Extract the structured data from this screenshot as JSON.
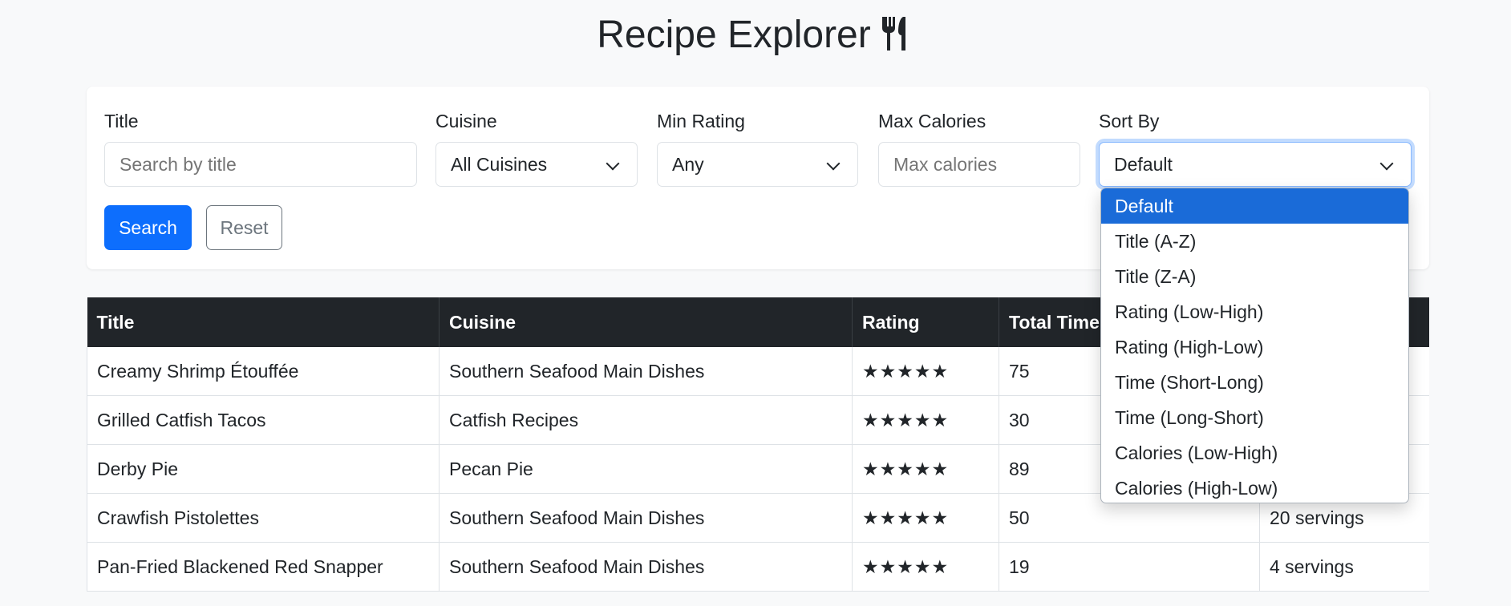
{
  "header": {
    "title": "Recipe Explorer"
  },
  "filters": {
    "title": {
      "label": "Title",
      "placeholder": "Search by title"
    },
    "cuisine": {
      "label": "Cuisine",
      "value": "All Cuisines"
    },
    "min_rating": {
      "label": "Min Rating",
      "value": "Any"
    },
    "max_calories": {
      "label": "Max Calories",
      "placeholder": "Max calories"
    },
    "sort_by": {
      "label": "Sort By",
      "value": "Default",
      "options": [
        "Default",
        "Title (A-Z)",
        "Title (Z-A)",
        "Rating (Low-High)",
        "Rating (High-Low)",
        "Time (Short-Long)",
        "Time (Long-Short)",
        "Calories (Low-High)",
        "Calories (High-Low)"
      ]
    },
    "search_label": "Search",
    "reset_label": "Reset"
  },
  "table": {
    "columns": [
      "Title",
      "Cuisine",
      "Rating",
      "Total Time",
      ""
    ],
    "rows": [
      {
        "title": "Creamy Shrimp Étouffée",
        "cuisine": "Southern Seafood Main Dishes",
        "rating": "★★★★★",
        "time": "75",
        "servings": ""
      },
      {
        "title": "Grilled Catfish Tacos",
        "cuisine": "Catfish Recipes",
        "rating": "★★★★★",
        "time": "30",
        "servings": ""
      },
      {
        "title": "Derby Pie",
        "cuisine": "Pecan Pie",
        "rating": "★★★★★",
        "time": "89",
        "servings": ""
      },
      {
        "title": "Crawfish Pistolettes",
        "cuisine": "Southern Seafood Main Dishes",
        "rating": "★★★★★",
        "time": "50",
        "servings": "20 servings"
      },
      {
        "title": "Pan-Fried Blackened Red Snapper",
        "cuisine": "Southern Seafood Main Dishes",
        "rating": "★★★★★",
        "time": "19",
        "servings": "4 servings"
      }
    ]
  },
  "colors": {
    "primary": "#0d6efd",
    "header_dark": "#212529",
    "selected_option": "#1a6bd8"
  },
  "icons": {
    "title_icon": "utensils-icon"
  }
}
